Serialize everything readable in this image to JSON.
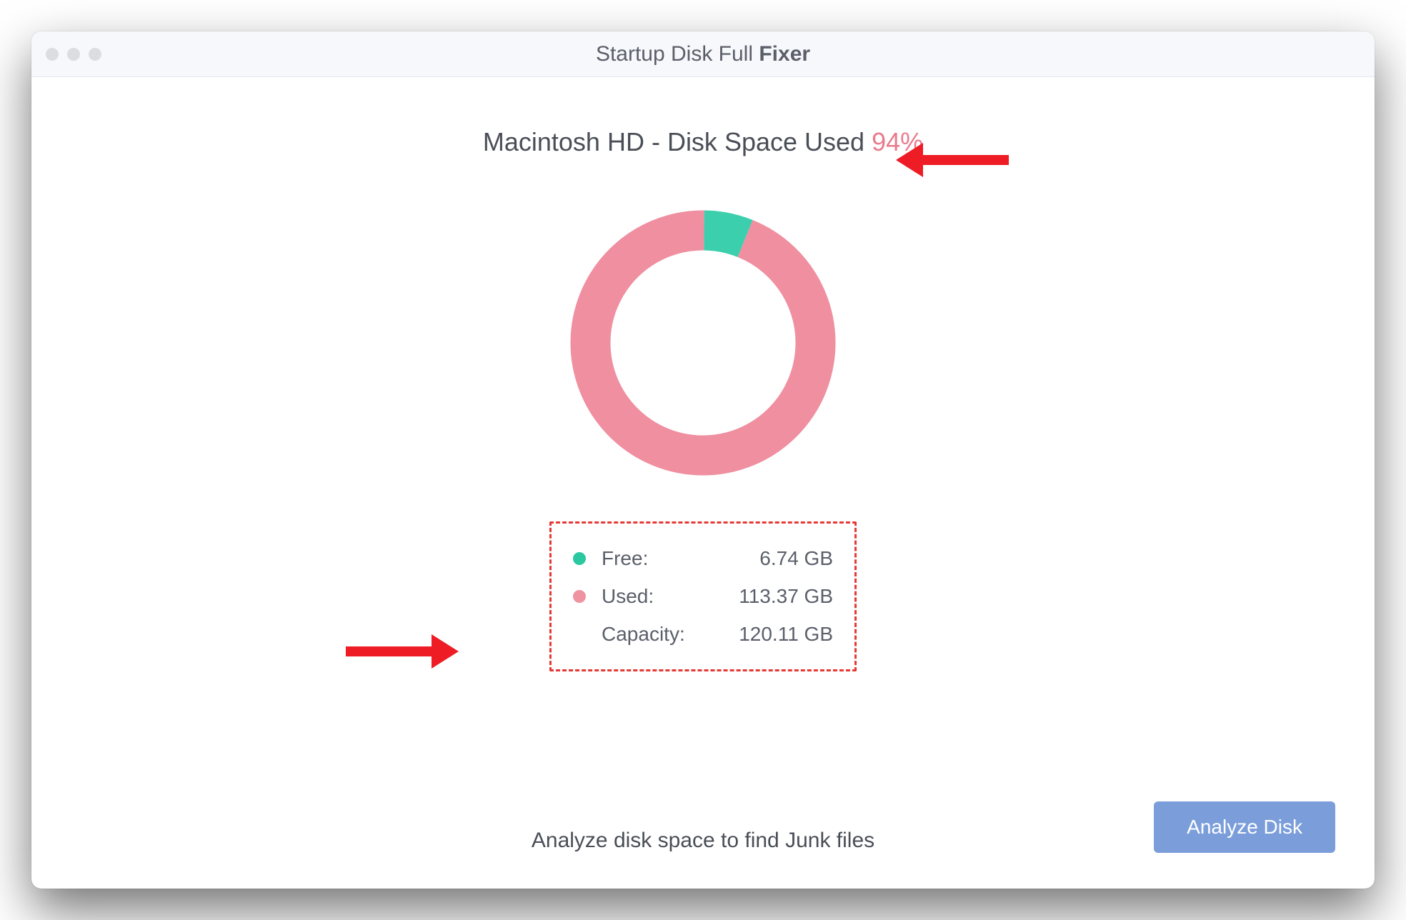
{
  "titlebar": {
    "prefix": "Startup Disk Full ",
    "bold": "Fixer"
  },
  "heading": {
    "prefix": "Macintosh HD - Disk Space Used ",
    "percent": "94%"
  },
  "chart_data": {
    "type": "pie",
    "title": "Disk Space Used",
    "series": [
      {
        "name": "Used",
        "value": 113.37,
        "percent": 94,
        "color": "#ef8fa0"
      },
      {
        "name": "Free",
        "value": 6.74,
        "percent": 6,
        "color": "#3ccfae"
      }
    ],
    "unit": "GB",
    "donut": true
  },
  "legend": {
    "free_label": "Free:",
    "free_value": "6.74 GB",
    "used_label": "Used:",
    "used_value": "113.37 GB",
    "capacity_label": "Capacity:",
    "capacity_value": "120.11 GB"
  },
  "hint": "Analyze disk space to find Junk files",
  "buttons": {
    "analyze": "Analyze Disk"
  },
  "colors": {
    "used": "#ef8fa0",
    "free": "#3ccfae",
    "accent_text": "#ea7a8d",
    "annotation": "#ee1c25",
    "primary_button": "#7b9edb"
  }
}
